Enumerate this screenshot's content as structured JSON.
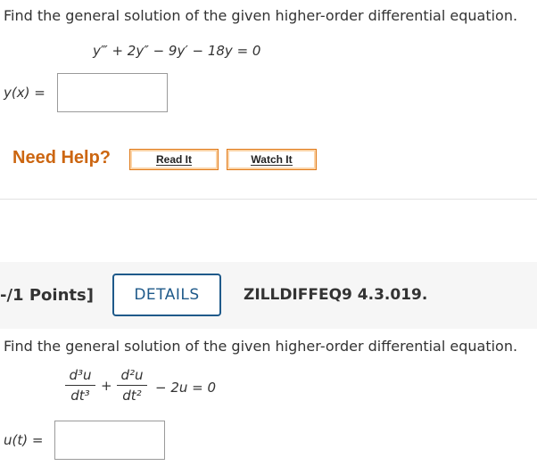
{
  "q1": {
    "prompt": "Find the general solution of the given higher-order differential equation.",
    "equation": "y‴ + 2y″ − 9y′ − 18y = 0",
    "answer_label": "y(x) ="
  },
  "help": {
    "label": "Need Help?",
    "read_it": "Read It",
    "watch_it": "Watch It"
  },
  "q2": {
    "points": "-/1 Points]",
    "details": "DETAILS",
    "problem_id": "ZILLDIFFEQ9 4.3.019.",
    "prompt": "Find the general solution of the given higher-order differential equation.",
    "eq_frac1_num": "d³u",
    "eq_frac1_den": "dt³",
    "eq_plus": "+",
    "eq_frac2_num": "d²u",
    "eq_frac2_den": "dt²",
    "eq_rest": "− 2u = 0",
    "answer_label": "u(t) ="
  }
}
